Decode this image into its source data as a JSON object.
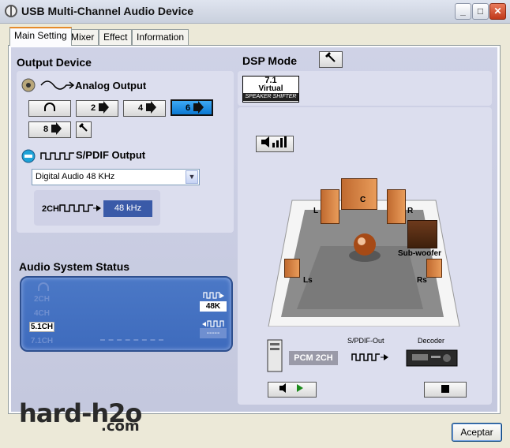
{
  "window": {
    "title": "USB Multi-Channel Audio Device",
    "min": "_",
    "max": "□",
    "close": "✕"
  },
  "tabs": [
    {
      "label": "Main Setting"
    },
    {
      "label": "Mixer"
    },
    {
      "label": "Effect"
    },
    {
      "label": "Information"
    }
  ],
  "output_device": {
    "title": "Output Device",
    "analog_label": "Analog Output",
    "channel_buttons": [
      "2",
      "4",
      "6",
      "8"
    ],
    "selected_channels": "6",
    "spdif_label": "S/PDIF Output",
    "spdif_select": "Digital Audio 48 KHz",
    "spdif_channels": "2CH",
    "spdif_rate": "48 kHz"
  },
  "audio_status": {
    "title": "Audio System Status",
    "channels": [
      "2CH",
      "4CH",
      "5.1CH",
      "7.1CH"
    ],
    "active_channel": "5.1CH",
    "rate": "48K",
    "input_rate": "-----"
  },
  "dsp": {
    "title": "DSP Mode",
    "badge_top": "7.1",
    "badge_mid": "Virtual",
    "badge_bottom": "SPEAKER SHIFTER",
    "speakers": {
      "c": "C",
      "l": "L",
      "r": "R",
      "sub": "Sub-woofer",
      "ls": "Ls",
      "rs": "Rs"
    },
    "pcm": "PCM 2CH",
    "spdif_out": "S/PDIF-Out",
    "decoder": "Decoder"
  },
  "watermark": {
    "main": "hard-h2o",
    "sub": ".com"
  },
  "ok_label": "Aceptar"
}
